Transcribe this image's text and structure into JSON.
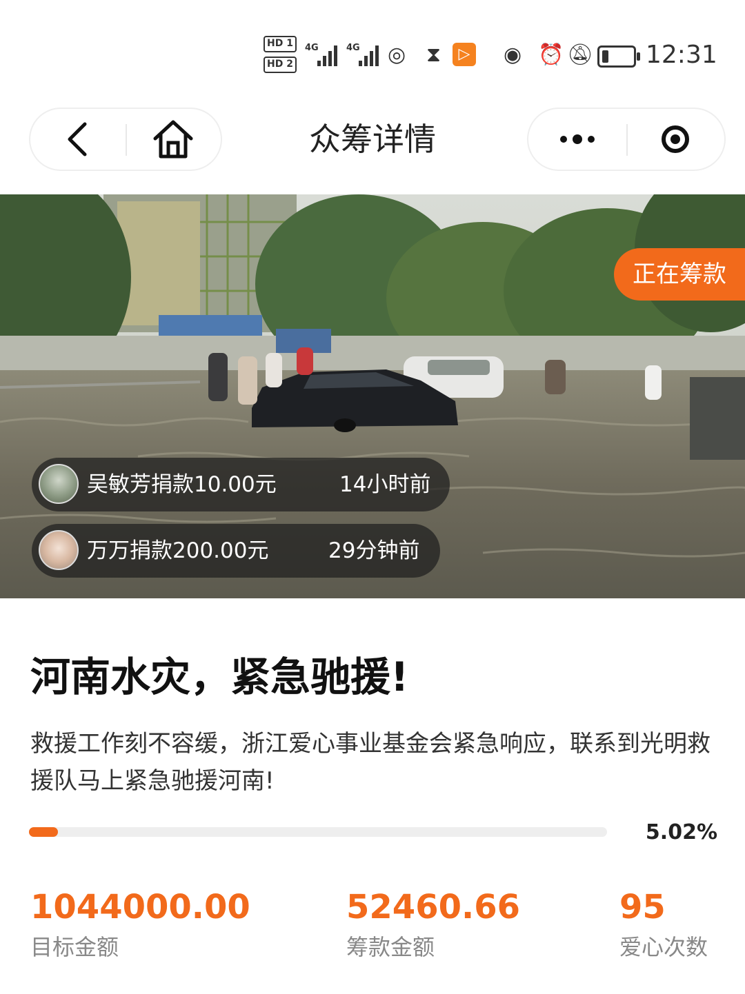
{
  "status_bar": {
    "hd1": "HD 1",
    "hd2": "HD 2",
    "signal1": "4G",
    "signal2": "4G",
    "time": "12:31"
  },
  "nav": {
    "title": "众筹详情"
  },
  "hero": {
    "badge": "正在筹款",
    "donations": [
      {
        "text": "吴敏芳捐款10.00元",
        "time": "14小时前"
      },
      {
        "text": "万万捐款200.00元",
        "time": "29分钟前"
      }
    ]
  },
  "campaign": {
    "title": "河南水灾，紧急驰援!",
    "description": "救援工作刻不容缓，浙江爱心事业基金会紧急响应，联系到光明救援队马上紧急驰援河南!",
    "progress_label": "5.02%",
    "progress_fraction": 0.0502,
    "stats": [
      {
        "value": "1044000.00",
        "label": "目标金额"
      },
      {
        "value": "52460.66",
        "label": "筹款金额"
      },
      {
        "value": "95",
        "label": "爱心次数"
      }
    ]
  },
  "colors": {
    "accent": "#f26a1b"
  }
}
